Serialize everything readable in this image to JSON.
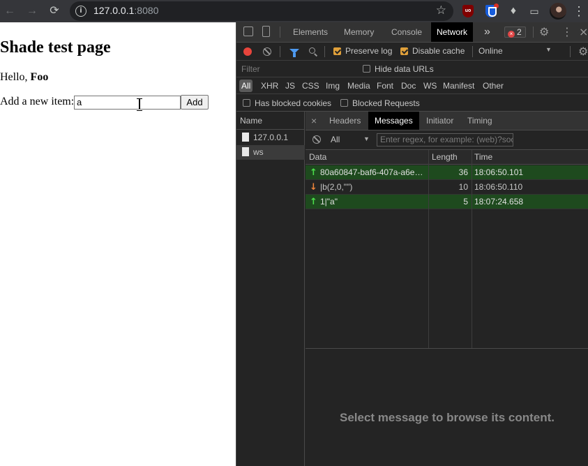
{
  "browser": {
    "url_host": "127.0.0.1",
    "url_port": ":8080",
    "extensions": {
      "ublock_label": "uo"
    }
  },
  "page": {
    "heading": "Shade test page",
    "greeting_prefix": "Hello,",
    "greeting_name": "Foo",
    "add_label": "Add a new item:",
    "item_input_value": "a",
    "add_button_label": "Add"
  },
  "devtools": {
    "tabs": [
      "Elements",
      "Memory",
      "Console",
      "Network"
    ],
    "active_tab": "Network",
    "more_tabs": "»",
    "error_count": "2",
    "toolbar": {
      "preserve_log_label": "Preserve log",
      "preserve_log_checked": true,
      "disable_cache_label": "Disable cache",
      "disable_cache_checked": true,
      "throttling": "Online"
    },
    "filter": {
      "placeholder": "Filter",
      "hide_data_urls_label": "Hide data URLs"
    },
    "types": [
      "All",
      "XHR",
      "JS",
      "CSS",
      "Img",
      "Media",
      "Font",
      "Doc",
      "WS",
      "Manifest",
      "Other"
    ],
    "active_type": "All",
    "has_blocked_cookies_label": "Has blocked cookies",
    "blocked_requests_label": "Blocked Requests",
    "requests": {
      "header": "Name",
      "items": [
        "127.0.0.1",
        "ws"
      ],
      "selected": "ws"
    },
    "detail": {
      "close": "×",
      "tabs": [
        "Headers",
        "Messages",
        "Initiator",
        "Timing"
      ],
      "active_tab": "Messages",
      "message_type_filter": "All",
      "regex_placeholder": "Enter regex, for example: (web)?socket",
      "columns": [
        "Data",
        "Length",
        "Time"
      ],
      "messages": [
        {
          "direction": "sent",
          "data": "80a60847-baf6-407a-a6e…",
          "length": "36",
          "time": "18:06:50.101"
        },
        {
          "direction": "received",
          "data": "|b(2,0,\"\")",
          "length": "10",
          "time": "18:06:50.110"
        },
        {
          "direction": "sent",
          "data": "1|\"a\"",
          "length": "5",
          "time": "18:07:24.658"
        }
      ],
      "preview_placeholder": "Select message to browse its content."
    }
  },
  "colors": {
    "sent_row": "#1e4a1e",
    "sent_arrow": "#4ce04c",
    "received_arrow": "#f0853a",
    "record": "#e8453c",
    "checkbox_on": "#e0a03a"
  }
}
